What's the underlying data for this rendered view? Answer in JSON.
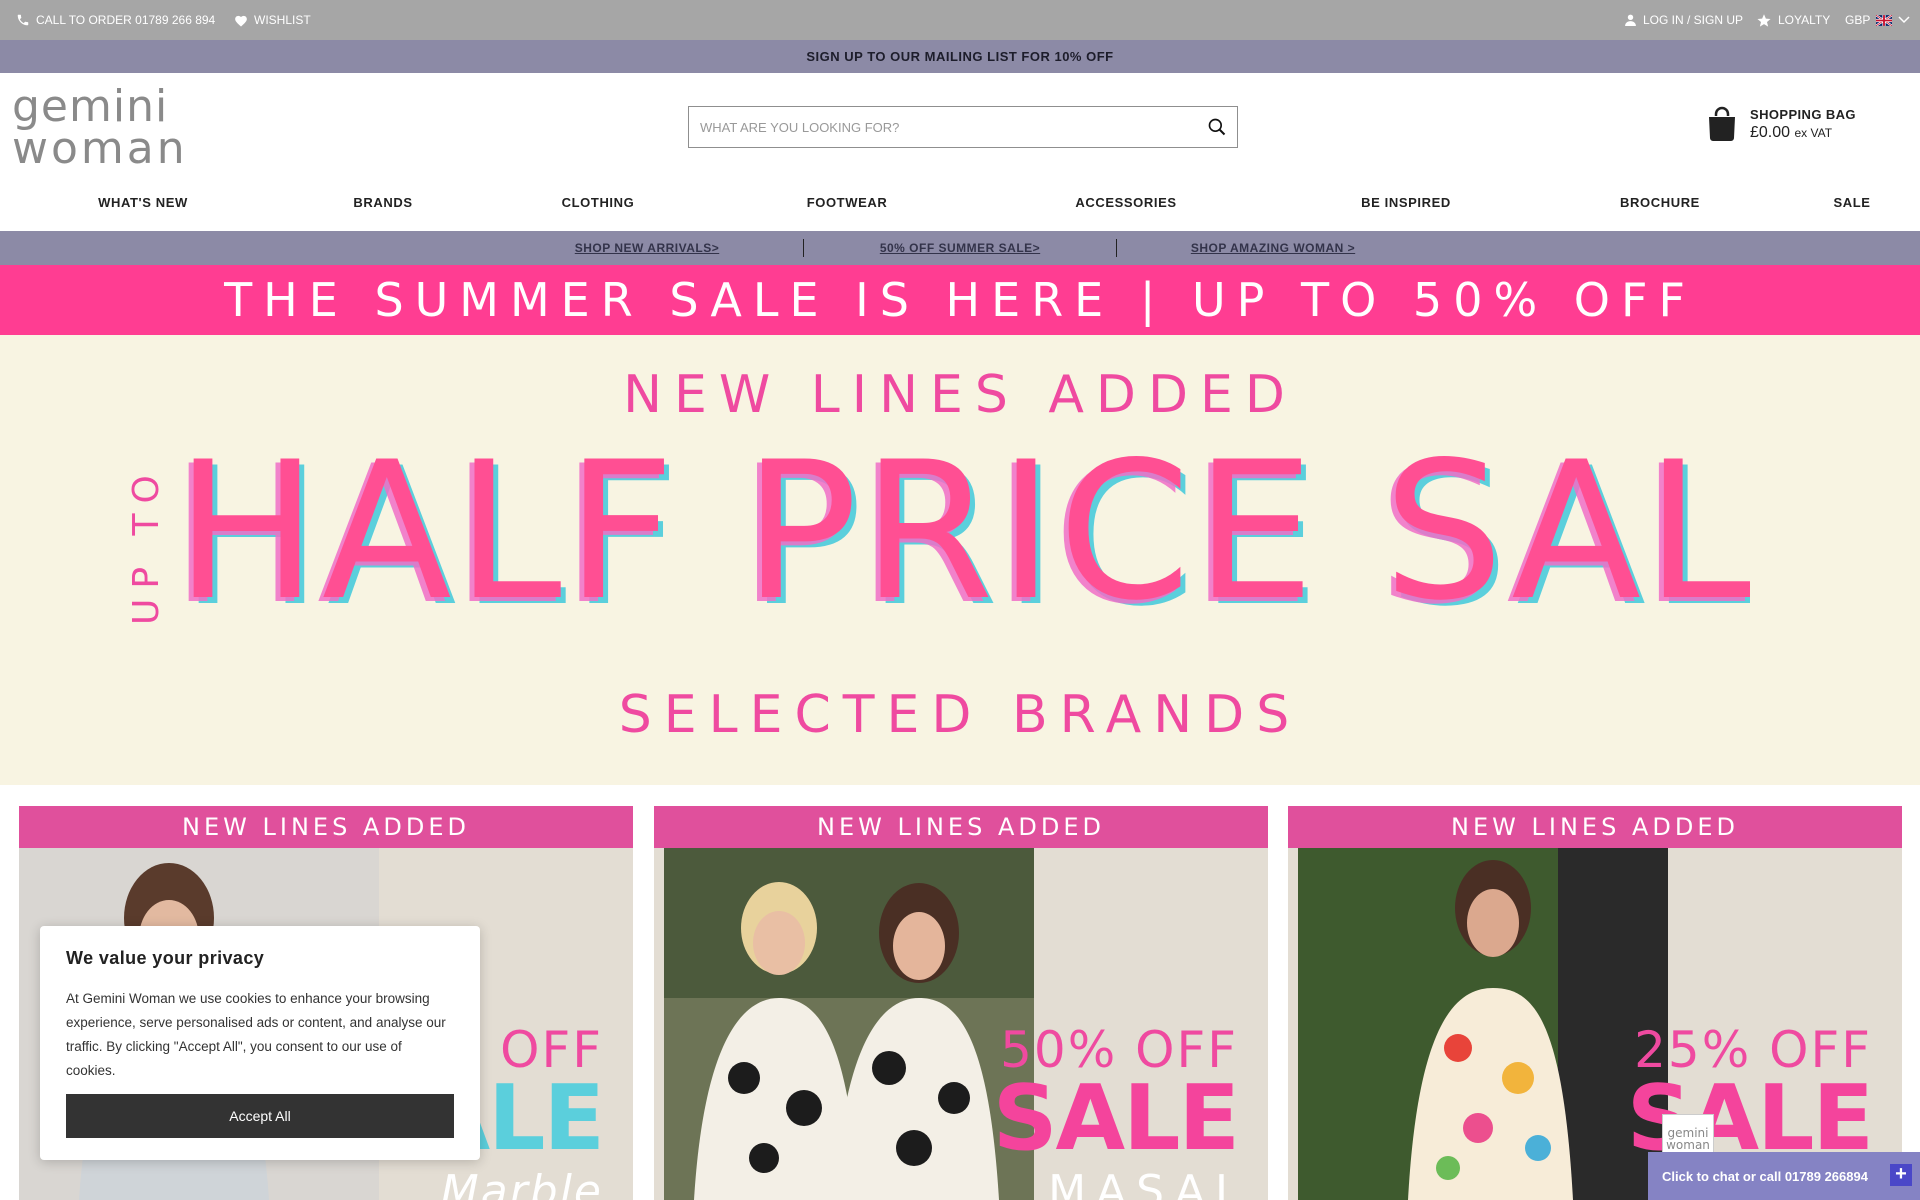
{
  "topbar": {
    "call": "CALL TO ORDER 01789 266 894",
    "wishlist": "WISHLIST",
    "login": "LOG IN / SIGN UP",
    "loyalty": "LOYALTY",
    "currency": "GBP"
  },
  "mailing": "SIGN UP TO OUR MAILING LIST FOR 10% OFF",
  "logo": {
    "line1": "gemini",
    "line2": "woman"
  },
  "search": {
    "placeholder": "WHAT ARE YOU LOOKING FOR?",
    "value": ""
  },
  "bag": {
    "label": "SHOPPING BAG",
    "amount": "£0.00",
    "suffix": "ex VAT"
  },
  "nav": [
    "WHAT'S NEW",
    "BRANDS",
    "CLOTHING",
    "FOOTWEAR",
    "ACCESSORIES",
    "BE INSPIRED",
    "BROCHURE",
    "SALE"
  ],
  "promo": [
    "SHOP NEW ARRIVALS>",
    "50% OFF SUMMER SALE>",
    "SHOP AMAZING WOMAN >"
  ],
  "sale_banner": "THE SUMMER SALE IS HERE | UP TO 50% OFF",
  "hero": {
    "top": "NEW LINES ADDED",
    "upto": "UP TO",
    "headline": "HALF PRICE SALE",
    "bottom": "SELECTED BRANDS"
  },
  "cards": [
    {
      "band": "NEW LINES ADDED",
      "discount": "OFF",
      "sale": "SALE",
      "brand": "Marble"
    },
    {
      "band": "NEW LINES ADDED",
      "discount": "50% OFF",
      "sale": "SALE",
      "brand": "MASAI"
    },
    {
      "band": "NEW LINES ADDED",
      "discount": "25% OFF",
      "sale": "SALE",
      "brand": ""
    }
  ],
  "cookie": {
    "title": "We value your privacy",
    "body": "At Gemini Woman we use cookies to enhance your browsing experience, serve personalised ads or content, and analyse our traffic. By clicking \"Accept All\", you consent to our use of cookies.",
    "accept": "Accept All"
  },
  "chat": {
    "label": "Click to chat or call 01789 266894",
    "logo_line1": "gemini",
    "logo_line2": "woman"
  },
  "colors": {
    "accent_pink": "#ff3d92",
    "lavender": "#8c8aa6",
    "hero_bg": "#f8f4e2"
  }
}
